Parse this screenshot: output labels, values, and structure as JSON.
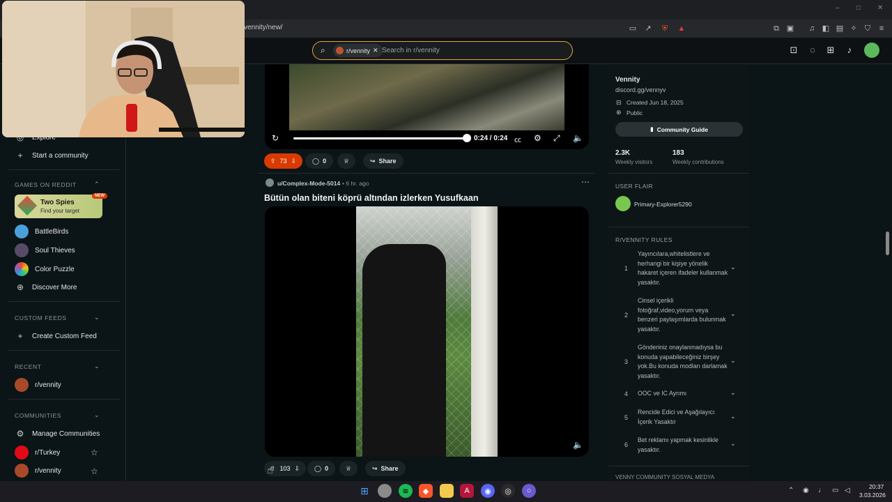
{
  "browser": {
    "address": "vennity/new/",
    "window_controls": [
      "–",
      "□",
      "✕"
    ]
  },
  "header": {
    "search_chip": "r/vennity",
    "search_placeholder": "Search in r/vennity"
  },
  "sidebar": {
    "explore": "Explore",
    "start_community": "Start a community",
    "games_heading": "GAMES ON REDDIT",
    "featured_game": {
      "title": "Two Spies",
      "subtitle": "Find your target",
      "badge": "NEW"
    },
    "games": [
      "BattleBirds",
      "Soul Thieves",
      "Color Puzzle"
    ],
    "discover_more": "Discover More",
    "custom_feeds_heading": "CUSTOM FEEDS",
    "create_custom_feed": "Create Custom Feed",
    "recent_heading": "RECENT",
    "recent": [
      "r/vennity"
    ],
    "communities_heading": "COMMUNITIES",
    "manage_communities": "Manage Communities",
    "communities": [
      "r/Turkey",
      "r/vennity"
    ]
  },
  "post1": {
    "time_display": "0:24 / 0:24",
    "progress": 1.0,
    "votes": "73",
    "comments": "0",
    "share": "Share"
  },
  "post2": {
    "author": "u/Complex-Mode-5014",
    "time": "• 6 hr. ago",
    "title": "Bütün olan biteni köprü altından izlerken Yusufkaan",
    "votes": "103",
    "comments": "0",
    "share": "Share"
  },
  "right": {
    "name": "Vennity",
    "discord": "discord.gg/vennyv",
    "created": "Created Jun 18, 2025",
    "visibility": "Public",
    "guide_button": "Community Guide",
    "stats": [
      {
        "value": "2.3K",
        "label": "Weekly visitors"
      },
      {
        "value": "183",
        "label": "Weekly contributions"
      }
    ],
    "flair_heading": "USER FLAIR",
    "flair_name": "Primary-Explorer5290",
    "rules_heading": "R/VENNITY RULES",
    "rules": [
      {
        "n": "1",
        "text": "Yayıncılara,whitelistlere ve herhangi bir kişiye yönelik hakaret içeren ifadeler kullanmak yasaktır."
      },
      {
        "n": "2",
        "text": "Cinsel içerikli fotoğraf,video,yorum veya benzeri paylaşımlarda bulunmak yasaktır."
      },
      {
        "n": "3",
        "text": "Gönderiniz onaylanmadıysa bu konuda yapabileceğiniz birşey yok.Bu konuda modları darlamak yasaktır."
      },
      {
        "n": "4",
        "text": "OOC ve IC Ayrımı"
      },
      {
        "n": "5",
        "text": "Rencide Edici ve Aşağılayıcı İçerik Yasaktır"
      },
      {
        "n": "6",
        "text": "Bet reklamı yapmak kesinlikle yasaktır."
      }
    ],
    "footer_heading": "VENNY COMMUNITY SOSYAL MEDYA"
  },
  "taskbar": {
    "time": "20:37",
    "date": "3.03.2026"
  }
}
